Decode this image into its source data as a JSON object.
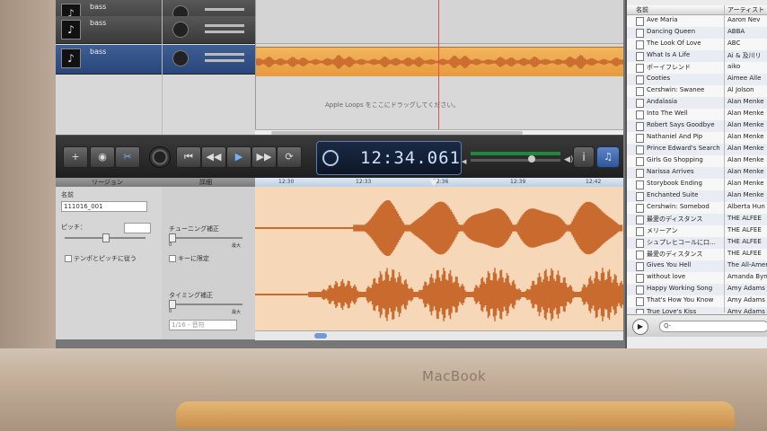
{
  "device": {
    "brand_label": "MacBook"
  },
  "tracks": [
    {
      "name": "bass",
      "selected": false
    },
    {
      "name": "bass",
      "selected": false
    },
    {
      "name": "bass",
      "selected": true
    }
  ],
  "tracks_area": {
    "drop_hint": "Apple Loops をここにドラッグしてください。"
  },
  "transport": {
    "add_label": "+",
    "eye_label": "◉",
    "edit_label": "✂",
    "go_start_label": "⏮",
    "rewind_label": "◀◀",
    "play_label": "▶",
    "forward_label": "▶▶",
    "cycle_label": "⟳",
    "time": "12:34.061",
    "info_label": "i",
    "media_label": "♫"
  },
  "editor": {
    "tab_region": "リージョン",
    "tab_detail": "詳細",
    "name_label": "名前",
    "name_value": "111016_001",
    "pitch_label": "ピッチ：",
    "tempo_pitch_label": "テンポとピッチに従う",
    "tuning_label": "チューニング補正",
    "tuning_min": "0",
    "tuning_max": "最大",
    "key_label": "キーに限定",
    "timing_label": "タイミング補正",
    "timing_min": "0",
    "timing_max": "最大",
    "quantize_value": "1/16 - 音符",
    "ruler_ticks": [
      "12:30",
      "12:33",
      "12:36",
      "12:39",
      "12:42"
    ]
  },
  "browser": {
    "col_title": "名前",
    "col_artist": "アーティスト",
    "rows": [
      {
        "title": "Ave Maria",
        "artist": "Aaron Nev"
      },
      {
        "title": "Dancing Queen",
        "artist": "ABBA"
      },
      {
        "title": "The Look Of Love",
        "artist": "ABC"
      },
      {
        "title": "What Is A Life",
        "artist": "Ai & 及川リ"
      },
      {
        "title": "ボーイフレンド",
        "artist": "aiko"
      },
      {
        "title": "Cooties",
        "artist": "Aimee Alle"
      },
      {
        "title": "Cershwin: Swanee",
        "artist": "Al Jolson"
      },
      {
        "title": "Andalasia",
        "artist": "Alan Menke"
      },
      {
        "title": "Into The Well",
        "artist": "Alan Menke"
      },
      {
        "title": "Robert Says Goodbye",
        "artist": "Alan Menke"
      },
      {
        "title": "Nathaniel And Pip",
        "artist": "Alan Menke"
      },
      {
        "title": "Prince Edward's Search",
        "artist": "Alan Menke"
      },
      {
        "title": "Girls Go Shopping",
        "artist": "Alan Menke"
      },
      {
        "title": "Narissa Arrives",
        "artist": "Alan Menke"
      },
      {
        "title": "Storybook Ending",
        "artist": "Alan Menke"
      },
      {
        "title": "Enchanted Suite",
        "artist": "Alan Menke"
      },
      {
        "title": "Cershwin: Somebod",
        "artist": "Alberta Hun"
      },
      {
        "title": "最愛のディスタンス",
        "artist": "THE ALFEE"
      },
      {
        "title": "メリーアン",
        "artist": "THE ALFEE"
      },
      {
        "title": "シュプレヒコールに口…",
        "artist": "THE ALFEE"
      },
      {
        "title": "最愛のディスタンス",
        "artist": "THE ALFEE"
      },
      {
        "title": "Gives You Hell",
        "artist": "The All-Amer"
      },
      {
        "title": "without love",
        "artist": "Amanda Byne"
      },
      {
        "title": "Happy Working Song",
        "artist": "Amy Adams"
      },
      {
        "title": "That's How You Know",
        "artist": "Amy Adams"
      },
      {
        "title": "True Love's Kiss",
        "artist": "Amy Adams"
      }
    ],
    "search_placeholder": "Q-"
  },
  "colors": {
    "waveform": "#c96a2e",
    "region_bg": "#f6d7b8",
    "selected_track": "#3e5f95",
    "lcd_text": "#cfe2ff"
  }
}
